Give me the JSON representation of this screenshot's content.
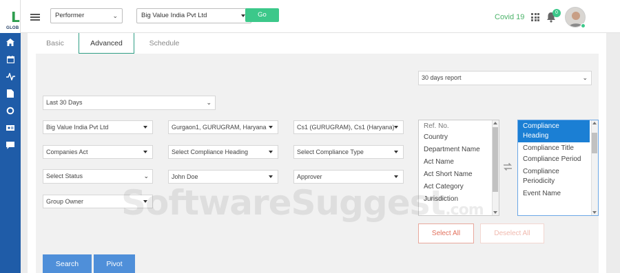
{
  "brand": {
    "logo_letter": "L",
    "logo_sub": "GLOB"
  },
  "sidebar": {
    "icons": [
      "home-icon",
      "calendar-icon",
      "activity-icon",
      "document-icon",
      "refresh-icon",
      "id-card-icon",
      "chat-icon"
    ]
  },
  "header": {
    "role_select": "Performer",
    "entity_select": "Big Value India Pvt Ltd",
    "go_label": "Go",
    "covid_label": "Covid 19",
    "notification_count": "0"
  },
  "tabs": [
    {
      "label": "Basic",
      "active": false
    },
    {
      "label": "Advanced",
      "active": true
    },
    {
      "label": "Schedule",
      "active": false
    }
  ],
  "filters": {
    "report_select": "30 days report",
    "period_select": "Last 30 Days",
    "entity": "Big Value India Pvt Ltd",
    "location": "Gurgaon1, GURUGRAM, Haryana",
    "act_scope": "Cs1 (GURUGRAM), Cs1 (Haryana)",
    "act": "Companies Act",
    "compliance_heading": "Select Compliance Heading",
    "compliance_type": "Select Compliance Type",
    "status": "Select Status",
    "user": "John Doe",
    "approver": "Approver",
    "group": "Group Owner"
  },
  "available_columns": [
    "Ref. No.",
    "Country",
    "Department Name",
    "Act Name",
    "Act Short Name",
    "Act Category",
    "Jurisdiction"
  ],
  "selected_columns": [
    "Compliance Heading",
    "Compliance Title",
    "Compliance Period",
    "Compliance Periodicity",
    "Event Name"
  ],
  "buttons": {
    "select_all": "Select All",
    "deselect_all": "Deselect All",
    "search": "Search",
    "pivot": "Pivot"
  },
  "watermark": {
    "main": "SoftwareSuggest",
    "suffix": ".com"
  },
  "colors": {
    "rail": "#1f5ca8",
    "go": "#3cc88a",
    "accent_tab": "#2e9e84",
    "selected_item": "#1b7fd4",
    "search_button": "#4f8fd9",
    "select_all": "#e2705c"
  }
}
